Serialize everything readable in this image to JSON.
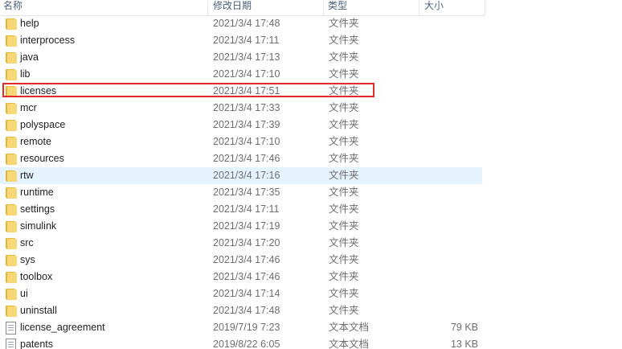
{
  "columns": {
    "name": "名称",
    "date": "修改日期",
    "type": "类型",
    "size": "大小"
  },
  "colors": {
    "hover_row": "#e5f3ff",
    "highlight": "#e32b2b",
    "folder": "#f8d776"
  },
  "files": [
    {
      "name": "help",
      "date": "2021/3/4 17:48",
      "type": "文件夹",
      "size": "",
      "icon": "folder-icon"
    },
    {
      "name": "interprocess",
      "date": "2021/3/4 17:11",
      "type": "文件夹",
      "size": "",
      "icon": "folder-icon"
    },
    {
      "name": "java",
      "date": "2021/3/4 17:13",
      "type": "文件夹",
      "size": "",
      "icon": "folder-icon"
    },
    {
      "name": "lib",
      "date": "2021/3/4 17:10",
      "type": "文件夹",
      "size": "",
      "icon": "folder-icon"
    },
    {
      "name": "licenses",
      "date": "2021/3/4 17:51",
      "type": "文件夹",
      "size": "",
      "icon": "folder-icon"
    },
    {
      "name": "mcr",
      "date": "2021/3/4 17:33",
      "type": "文件夹",
      "size": "",
      "icon": "folder-icon"
    },
    {
      "name": "polyspace",
      "date": "2021/3/4 17:39",
      "type": "文件夹",
      "size": "",
      "icon": "folder-icon"
    },
    {
      "name": "remote",
      "date": "2021/3/4 17:10",
      "type": "文件夹",
      "size": "",
      "icon": "folder-icon"
    },
    {
      "name": "resources",
      "date": "2021/3/4 17:46",
      "type": "文件夹",
      "size": "",
      "icon": "folder-icon"
    },
    {
      "name": "rtw",
      "date": "2021/3/4 17:16",
      "type": "文件夹",
      "size": "",
      "icon": "folder-icon"
    },
    {
      "name": "runtime",
      "date": "2021/3/4 17:35",
      "type": "文件夹",
      "size": "",
      "icon": "folder-icon"
    },
    {
      "name": "settings",
      "date": "2021/3/4 17:11",
      "type": "文件夹",
      "size": "",
      "icon": "folder-icon"
    },
    {
      "name": "simulink",
      "date": "2021/3/4 17:19",
      "type": "文件夹",
      "size": "",
      "icon": "folder-icon"
    },
    {
      "name": "src",
      "date": "2021/3/4 17:20",
      "type": "文件夹",
      "size": "",
      "icon": "folder-icon"
    },
    {
      "name": "sys",
      "date": "2021/3/4 17:46",
      "type": "文件夹",
      "size": "",
      "icon": "folder-icon"
    },
    {
      "name": "toolbox",
      "date": "2021/3/4 17:46",
      "type": "文件夹",
      "size": "",
      "icon": "folder-icon"
    },
    {
      "name": "ui",
      "date": "2021/3/4 17:14",
      "type": "文件夹",
      "size": "",
      "icon": "folder-icon"
    },
    {
      "name": "uninstall",
      "date": "2021/3/4 17:48",
      "type": "文件夹",
      "size": "",
      "icon": "folder-icon"
    },
    {
      "name": "license_agreement",
      "date": "2019/7/19 7:23",
      "type": "文本文档",
      "size": "79 KB",
      "icon": "text-document-icon"
    },
    {
      "name": "patents",
      "date": "2019/8/22 6:05",
      "type": "文本文档",
      "size": "13 KB",
      "icon": "text-document-icon"
    }
  ]
}
